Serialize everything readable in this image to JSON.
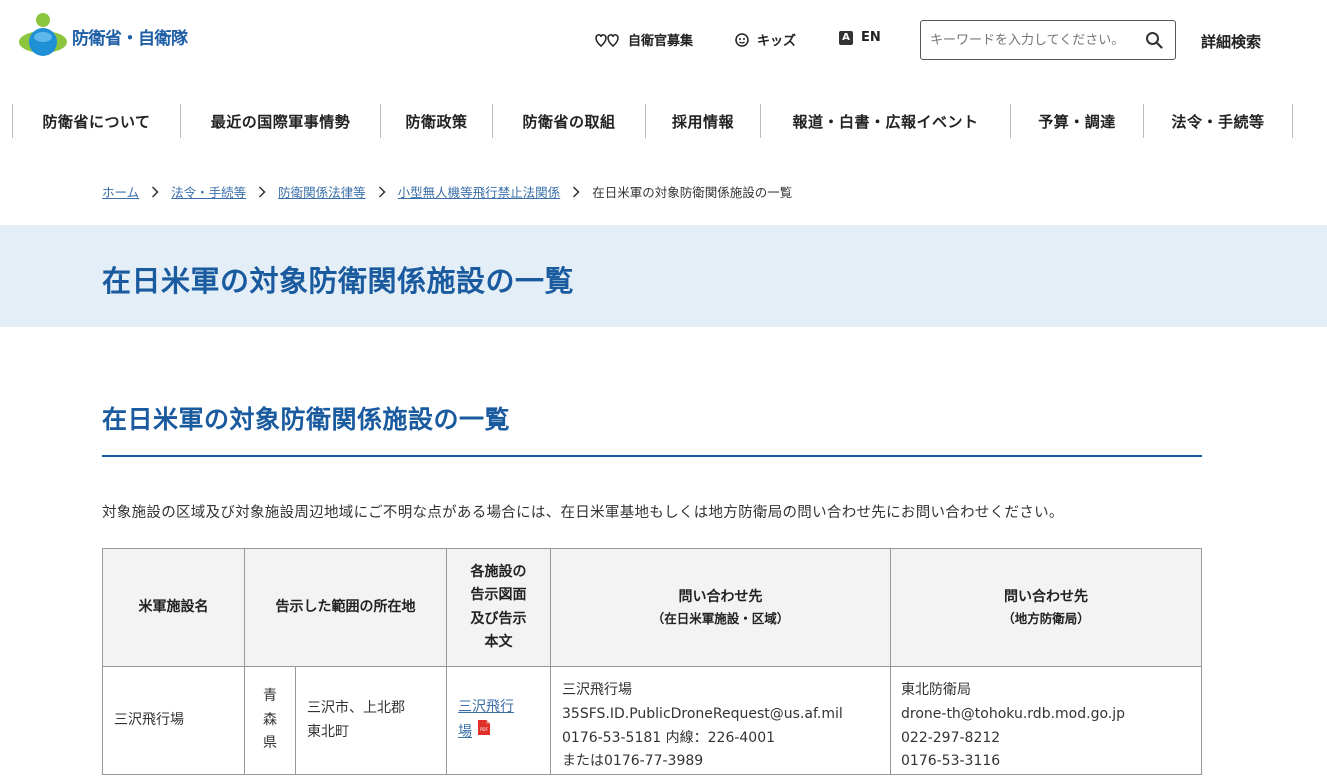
{
  "header": {
    "logo_text": "防衛省・自衛隊",
    "recruit_label": "自衛官募集",
    "kids_label": "キッズ",
    "en_badge": "A",
    "en_label": "EN",
    "search_placeholder": "キーワードを入力してください。",
    "advanced_search_label": "詳細検索"
  },
  "gnav": [
    {
      "label": "防衛省について"
    },
    {
      "label": "最近の国際軍事情勢"
    },
    {
      "label": "防衛政策"
    },
    {
      "label": "防衛省の取組"
    },
    {
      "label": "採用情報"
    },
    {
      "label": "報道・白書・広報イベント"
    },
    {
      "label": "予算・調達"
    },
    {
      "label": "法令・手続等"
    }
  ],
  "breadcrumb": {
    "items": [
      "ホーム",
      "法令・手続等",
      "防衛関係法律等",
      "小型無人機等飛行禁止法関係"
    ],
    "current": "在日米軍の対象防衛関係施設の一覧"
  },
  "page_title": "在日米軍の対象防衛関係施設の一覧",
  "section_title": "在日米軍の対象防衛関係施設の一覧",
  "lead": "対象施設の区域及び対象施設周辺地域にご不明な点がある場合には、在日米軍基地もしくは地方防衛局の問い合わせ先にお問い合わせください。",
  "table": {
    "headers": {
      "name": "米軍施設名",
      "location": "告示した範囲の所在地",
      "map_line1": "各施設の",
      "map_line2": "告示図面",
      "map_line3": "及び告示",
      "map_line4": "本文",
      "usf": "問い合わせ先",
      "usf_sub": "（在日米軍施設・区域）",
      "rdb": "問い合わせ先",
      "rdb_sub": "（地方防衛局）"
    },
    "rows": [
      {
        "name": "三沢飛行場",
        "pref": [
          "青",
          "森",
          "県"
        ],
        "city_line1": "三沢市、上北郡",
        "city_line2": "東北町",
        "map_link_line1": "三沢飛行",
        "map_link_line2": "場",
        "pdf_label": "PDF",
        "usf_lines": [
          "三沢飛行場",
          "35SFS.ID.PublicDroneRequest@us.af.mil",
          "0176-53-5181 内線：226-4001",
          "または0176-77-3989"
        ],
        "rdb_lines": [
          "東北防衛局",
          "drone-th@tohoku.rdb.mod.go.jp",
          "022-297-8212",
          "0176-53-3116"
        ]
      }
    ]
  }
}
